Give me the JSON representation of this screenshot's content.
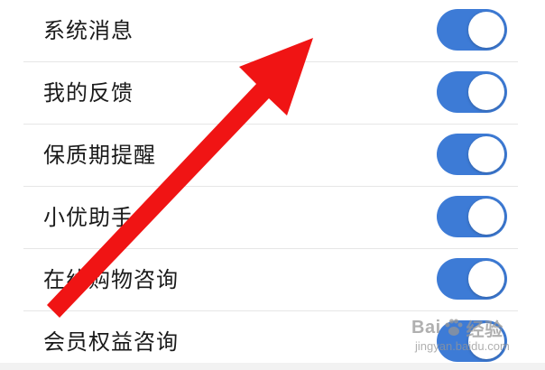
{
  "settings": {
    "items": [
      {
        "label": "系统消息",
        "enabled": true
      },
      {
        "label": "我的反馈",
        "enabled": true
      },
      {
        "label": "保质期提醒",
        "enabled": true
      },
      {
        "label": "小优助手",
        "enabled": true
      },
      {
        "label": "在线购物咨询",
        "enabled": true
      },
      {
        "label": "会员权益咨询",
        "enabled": true
      }
    ]
  },
  "colors": {
    "toggle_on": "#3d7bd6",
    "toggle_off": "#cfd3d8",
    "annotation_arrow": "#f01414",
    "watermark": "#969696"
  },
  "watermark": {
    "brand_left": "Bai",
    "brand_right": "经验",
    "url": "jingyan.baidu.com"
  }
}
